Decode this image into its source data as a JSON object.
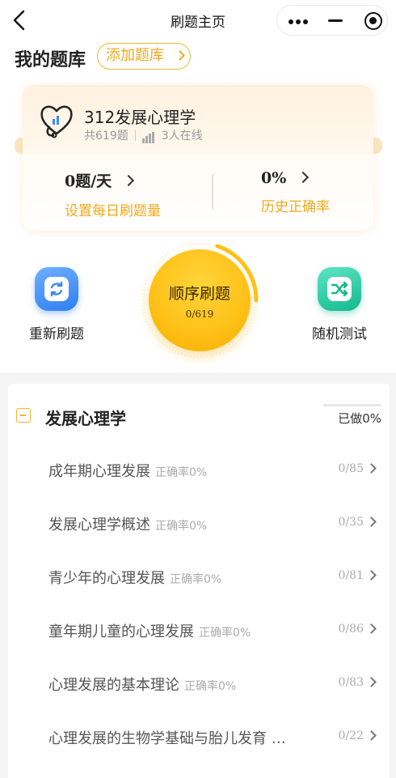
{
  "nav": {
    "title": "刷题主页"
  },
  "header": {
    "my_bank_title": "我的题库",
    "add_bank_label": "添加题库"
  },
  "bank": {
    "name": "312发展心理学",
    "total": "共619题",
    "online": "3人在线"
  },
  "stats": {
    "daily_value": "0题/天",
    "daily_label": "设置每日刷题量",
    "accuracy_value": "0%",
    "accuracy_label": "历史正确率"
  },
  "actions": {
    "redo_label": "重新刷题",
    "sequential_label": "顺序刷题",
    "sequential_progress": "0/619",
    "random_label": "随机测试"
  },
  "colors": {
    "accent": "#f0a91b",
    "redo_icon": "#3b8cf5",
    "random_icon": "#1fc9a0"
  },
  "chapter": {
    "title": "发展心理学",
    "done_label": "已做0%",
    "items": [
      {
        "name": "成年期心理发展",
        "accuracy": "正确率0%",
        "count": "0/85"
      },
      {
        "name": "发展心理学概述",
        "accuracy": "正确率0%",
        "count": "0/35"
      },
      {
        "name": "青少年的心理发展",
        "accuracy": "正确率0%",
        "count": "0/81"
      },
      {
        "name": "童年期儿童的心理发展",
        "accuracy": "正确率0%",
        "count": "0/86"
      },
      {
        "name": "心理发展的基本理论",
        "accuracy": "正确率0%",
        "count": "0/83"
      },
      {
        "name": "心理发展的生物学基础与胎儿发育 …",
        "accuracy": "",
        "count": "0/22"
      }
    ]
  }
}
